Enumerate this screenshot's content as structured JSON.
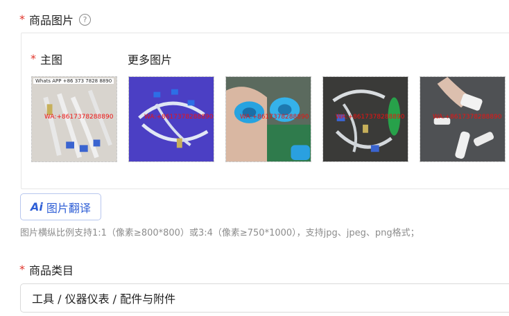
{
  "image_field": {
    "required_mark": "*",
    "label": "商品图片",
    "help_icon_text": "?",
    "main_label": "主图",
    "more_label": "更多图片",
    "thumbnails": [
      {
        "watermark": "WA:+8617378288890",
        "top_caption": "Whats APP +86 373 7828 8890"
      },
      {
        "watermark": "WA:+8617378288890",
        "top_caption": ""
      },
      {
        "watermark": "WA:+8617378288890",
        "top_caption": ""
      },
      {
        "watermark": "WA:+8617378288890",
        "top_caption": ""
      },
      {
        "watermark": "WA:+8617378288890",
        "top_caption": ""
      }
    ]
  },
  "translate_button": {
    "icon_text": "Ai",
    "label": "图片翻译"
  },
  "hint": "图片横纵比例支持1:1（像素≥800*800）或3:4（像素≥750*1000），支持jpg、jpeg、png格式；",
  "category_field": {
    "required_mark": "*",
    "label": "商品类目",
    "value": "工具 / 仪器仪表 / 配件与附件"
  },
  "colors": {
    "required": "#e0342a",
    "accent": "#2f5fd6",
    "hint": "#8c8c8c"
  }
}
